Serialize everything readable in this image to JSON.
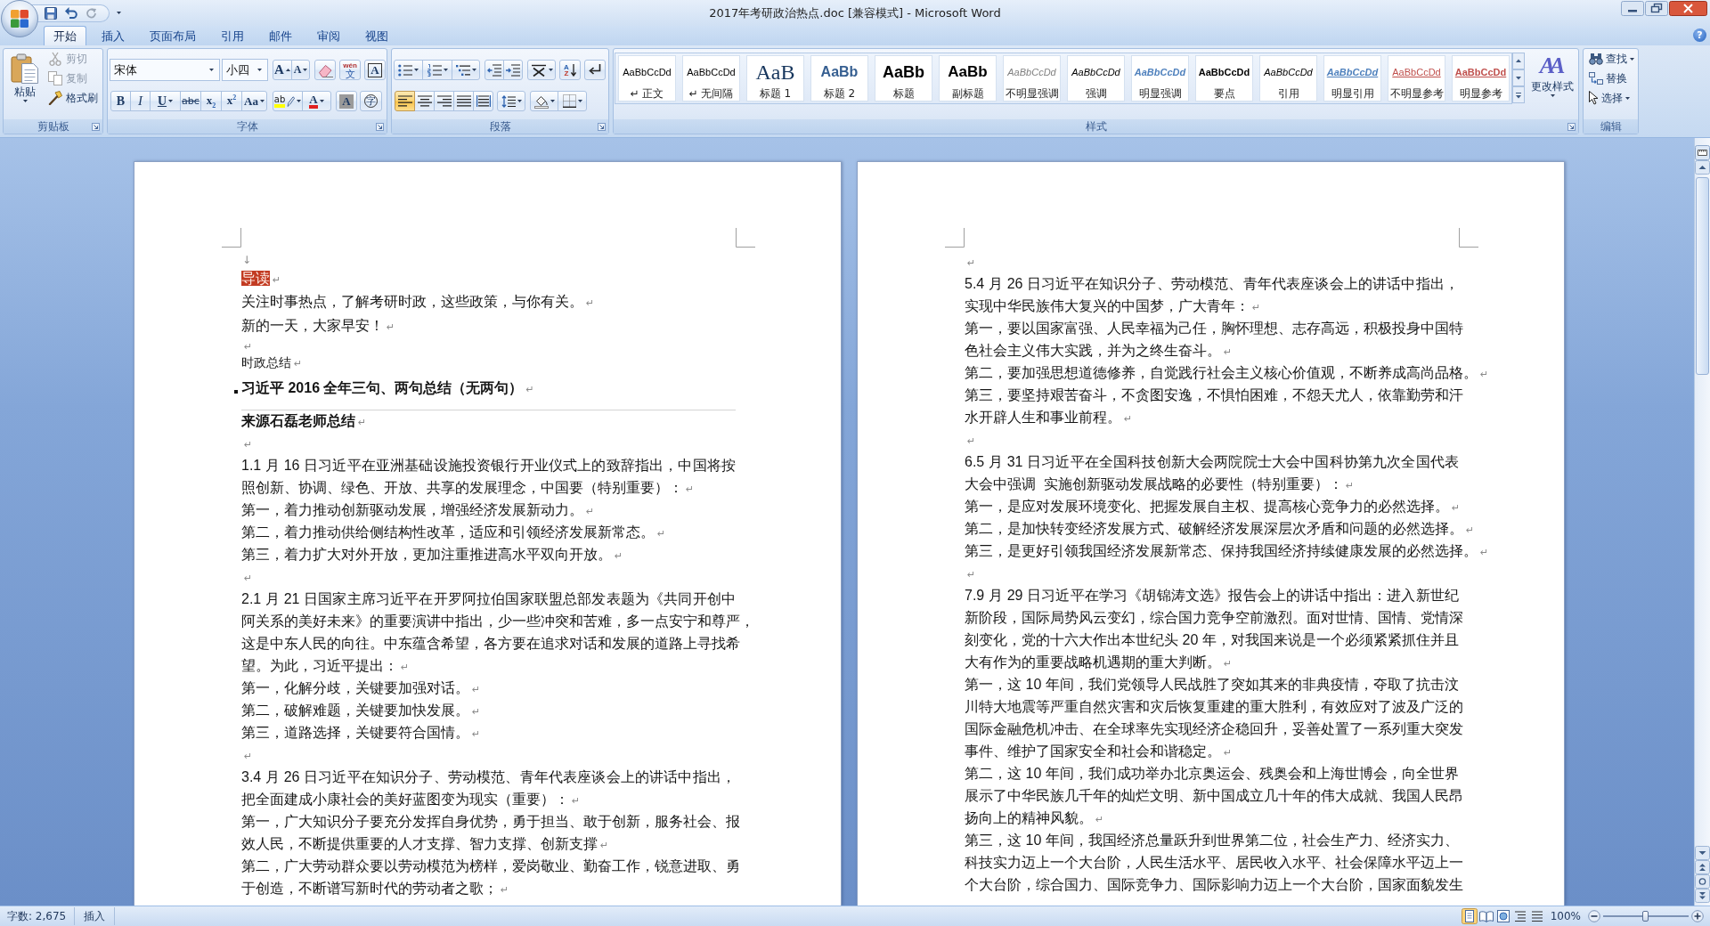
{
  "title_bar": {
    "title": "2017年考研政治热点.doc [兼容模式] - Microsoft Word"
  },
  "tabs": [
    {
      "label": "开始",
      "selected": true
    },
    {
      "label": "插入",
      "selected": false
    },
    {
      "label": "页面布局",
      "selected": false
    },
    {
      "label": "引用",
      "selected": false
    },
    {
      "label": "邮件",
      "selected": false
    },
    {
      "label": "审阅",
      "selected": false
    },
    {
      "label": "视图",
      "selected": false
    }
  ],
  "help": "?",
  "ribbon": {
    "clipboard": {
      "label": "剪贴板",
      "paste": "粘贴",
      "tools": [
        {
          "kind": "cut",
          "label": "剪切",
          "disabled": true
        },
        {
          "kind": "copy",
          "label": "复制",
          "disabled": true
        },
        {
          "kind": "painter",
          "label": "格式刷",
          "disabled": false
        }
      ]
    },
    "font": {
      "label": "字体",
      "font_name": "宋体",
      "font_size": "小四",
      "tools_1": [
        [
          {
            "kind": "grow",
            "text": "A"
          },
          {
            "kind": "shrink",
            "text": "A"
          }
        ],
        [
          {
            "kind": "clear"
          }
        ],
        [
          {
            "kind": "phonetic",
            "ruby": "wén",
            "text": "文"
          }
        ],
        [
          {
            "kind": "border",
            "text": "A"
          }
        ]
      ],
      "tools_2": [
        [
          {
            "kind": "bold",
            "text": "B"
          },
          {
            "kind": "italic",
            "text": "I"
          },
          {
            "kind": "underline",
            "text": "U"
          },
          {
            "kind": "strike",
            "text": "abc"
          },
          {
            "kind": "subscript",
            "text": "x$_{2}$"
          },
          {
            "kind": "superscript",
            "text": "x$^{2}$"
          },
          {
            "kind": "case",
            "text": "Aa"
          }
        ],
        [
          {
            "kind": "highlight",
            "text": "ab"
          },
          {
            "kind": "color",
            "text": "A"
          }
        ],
        [
          {
            "kind": "char-shading",
            "text": "A"
          }
        ],
        [
          {
            "kind": "enclose",
            "text": "字"
          }
        ]
      ]
    },
    "paragraph": {
      "label": "段落",
      "tools_1": [
        [
          {
            "kind": "bullets"
          },
          {
            "kind": "numbering"
          },
          {
            "kind": "multilevel"
          }
        ],
        [
          {
            "kind": "outdent"
          },
          {
            "kind": "indent"
          }
        ],
        [
          {
            "kind": "asian"
          }
        ],
        [
          {
            "kind": "sort",
            "letters": [
              "A",
              "Z"
            ]
          }
        ],
        [
          {
            "kind": "marks"
          }
        ]
      ],
      "alignment": [
        {
          "kind": "align-left",
          "selected": true
        },
        {
          "kind": "align-center",
          "selected": false
        },
        {
          "kind": "align-right",
          "selected": false
        },
        {
          "kind": "justify",
          "selected": false
        },
        {
          "kind": "distribute",
          "selected": false
        }
      ],
      "tools_2": [
        [
          {
            "kind": "line-spacing"
          }
        ],
        [
          {
            "kind": "shading"
          },
          {
            "kind": "borders"
          }
        ]
      ]
    },
    "styles": {
      "label": "样式",
      "gallery": [
        {
          "preview": "AaBbCcDd",
          "name": "↵ 正文",
          "kind": "normal"
        },
        {
          "preview": "AaBbCcDd",
          "name": "↵ 无间隔",
          "kind": "normal"
        },
        {
          "preview": "AaB",
          "name": "标题 1",
          "kind": "heading1"
        },
        {
          "preview": "AaBb",
          "name": "标题 2",
          "kind": "heading2"
        },
        {
          "preview": "AaBb",
          "name": "标题",
          "kind": "title"
        },
        {
          "preview": "AaBb",
          "name": "副标题",
          "kind": "subtitle"
        },
        {
          "preview": "AaBbCcDd",
          "name": "不明显强调",
          "kind": "subtle-emphasis"
        },
        {
          "preview": "AaBbCcDd",
          "name": "强调",
          "kind": "emphasis"
        },
        {
          "preview": "AaBbCcDd",
          "name": "明显强调",
          "kind": "intense-emphasis"
        },
        {
          "preview": "AaBbCcDd",
          "name": "要点",
          "kind": "strong"
        },
        {
          "preview": "AaBbCcDd",
          "name": "引用",
          "kind": "quote"
        },
        {
          "preview": "AaBbCcDd",
          "name": "明显引用",
          "kind": "intense-quote"
        },
        {
          "preview": "AaBbCcDd",
          "name": "不明显参考",
          "kind": "subtle-reference"
        },
        {
          "preview": "AaBbCcDd",
          "name": "明显参考",
          "kind": "intense-reference"
        }
      ],
      "change_styles": {
        "glyph": "AA",
        "label": "更改样式"
      }
    },
    "editing": {
      "label": "编辑",
      "tools": [
        {
          "kind": "find",
          "label": "查找"
        },
        {
          "kind": "replace",
          "label": "替换"
        },
        {
          "kind": "select",
          "label": "选择"
        }
      ]
    }
  },
  "document": {
    "pages": [
      {
        "paragraphs": [
          {
            "kind": "break",
            "mark": "↓"
          },
          {
            "kind": "highlight",
            "lines": [
              "导读"
            ],
            "mark": "↵"
          },
          {
            "kind": "intro",
            "lines": [
              "关注时事热点，了解考研时政，这些政策，与你有关。"
            ],
            "mark": "↵"
          },
          {
            "kind": "intro",
            "lines": [
              "新的一天，大家早安！"
            ],
            "mark": "↵"
          },
          {
            "kind": "small",
            "mark": "↵"
          },
          {
            "kind": "small",
            "lines": [
              "时政总结"
            ],
            "mark": "↵"
          },
          {
            "kind": "heading",
            "lines": [
              "习近平 2016 全年三句、两句总结（无两句）"
            ],
            "mark": "↵"
          },
          {
            "kind": "bold",
            "lines": [
              "来源石磊老师总结"
            ],
            "mark": "↵"
          },
          {
            "kind": "body",
            "mark": "↵"
          },
          {
            "kind": "body",
            "lines": [
              "1.1 月 16 日习近平在亚洲基础设施投资银行开业仪式上的致辞指出，中国将按",
              "照创新、协调、绿色、开放、共享的发展理念，中国要（特别重要）："
            ],
            "mark": "↵"
          },
          {
            "kind": "body",
            "lines": [
              "第一，着力推动创新驱动发展，增强经济发展新动力。"
            ],
            "mark": "↵"
          },
          {
            "kind": "body",
            "lines": [
              "第二，着力推动供给侧结构性改革，适应和引领经济发展新常态。"
            ],
            "mark": "↵"
          },
          {
            "kind": "body",
            "lines": [
              "第三，着力扩大对外开放，更加注重推进高水平双向开放。"
            ],
            "mark": "↵"
          },
          {
            "kind": "body",
            "mark": "↵"
          },
          {
            "kind": "body",
            "lines": [
              "2.1 月 21 日国家主席习近平在开罗阿拉伯国家联盟总部发表题为《共同开创中",
              "阿关系的美好未来》的重要演讲中指出，少一些冲突和苦难，多一点安宁和尊严，",
              "这是中东人民的向往。中东蕴含希望，各方要在追求对话和发展的道路上寻找希",
              "望。为此，习近平提出："
            ],
            "mark": "↵"
          },
          {
            "kind": "body",
            "lines": [
              "第一，化解分歧，关键要加强对话。"
            ],
            "mark": "↵"
          },
          {
            "kind": "body",
            "lines": [
              "第二，破解难题，关键要加快发展。"
            ],
            "mark": "↵"
          },
          {
            "kind": "body",
            "lines": [
              "第三，道路选择，关键要符合国情。"
            ],
            "mark": "↵"
          },
          {
            "kind": "body",
            "mark": "↵"
          },
          {
            "kind": "body",
            "lines": [
              "3.4 月 26 日习近平在知识分子、劳动模范、青年代表座谈会上的讲话中指出，",
              "把全面建成小康社会的美好蓝图变为现实（重要）："
            ],
            "mark": "↵"
          },
          {
            "kind": "body",
            "lines": [
              "第一，广大知识分子要充分发挥自身优势，勇于担当、敢于创新，服务社会、报",
              "效人民，不断提供重要的人才支撑、智力支撑、创新支撑"
            ],
            "mark": "↵"
          },
          {
            "kind": "body",
            "lines": [
              "第二，广大劳动群众要以劳动模范为榜样，爱岗敬业、勤奋工作，锐意进取、勇",
              "于创造，不断谱写新时代的劳动者之歌；"
            ],
            "mark": "↵"
          }
        ]
      },
      {
        "paragraphs": [
          {
            "kind": "body",
            "mark": "↵"
          },
          {
            "kind": "body",
            "lines": [
              "5.4 月 26 日习近平在知识分子、劳动模范、青年代表座谈会上的讲话中指出，",
              "实现中华民族伟大复兴的中国梦，广大青年："
            ],
            "mark": "↵"
          },
          {
            "kind": "body",
            "lines": [
              "第一，要以国家富强、人民幸福为己任，胸怀理想、志存高远，积极投身中国特",
              "色社会主义伟大实践，并为之终生奋斗。"
            ],
            "mark": "↵"
          },
          {
            "kind": "body",
            "lines": [
              "第二，要加强思想道德修养，自觉践行社会主义核心价值观，不断养成高尚品格。"
            ],
            "mark": "↵"
          },
          {
            "kind": "body",
            "lines": [
              "第三，要坚持艰苦奋斗，不贪图安逸，不惧怕困难，不怨天尤人，依靠勤劳和汗",
              "水开辟人生和事业前程。"
            ],
            "mark": "↵"
          },
          {
            "kind": "body",
            "mark": "↵"
          },
          {
            "kind": "body",
            "lines": [
              "6.5 月 31 日习近平在全国科技创新大会两院院士大会中国科协第九次全国代表",
              "大会中强调  实施创新驱动发展战略的必要性（特别重要）："
            ],
            "mark": "↵"
          },
          {
            "kind": "body",
            "lines": [
              "第一，是应对发展环境变化、把握发展自主权、提高核心竞争力的必然选择。"
            ],
            "mark": "↵"
          },
          {
            "kind": "body",
            "lines": [
              "第二，是加快转变经济发展方式、破解经济发展深层次矛盾和问题的必然选择。"
            ],
            "mark": "↵"
          },
          {
            "kind": "body",
            "lines": [
              "第三，是更好引领我国经济发展新常态、保持我国经济持续健康发展的必然选择。"
            ],
            "mark": "↵"
          },
          {
            "kind": "body",
            "mark": "↵"
          },
          {
            "kind": "body",
            "lines": [
              "7.9 月 29 日习近平在学习《胡锦涛文选》报告会上的讲话中指出：进入新世纪",
              "新阶段，国际局势风云变幻，综合国力竞争空前激烈。面对世情、国情、党情深",
              "刻变化，党的十六大作出本世纪头 20 年，对我国来说是一个必须紧紧抓住并且",
              "大有作为的重要战略机遇期的重大判断。"
            ],
            "mark": "↵"
          },
          {
            "kind": "body",
            "lines": [
              "第一，这 10 年间，我们党领导人民战胜了突如其来的非典疫情，夺取了抗击汶",
              "川特大地震等严重自然灾害和灾后恢复重建的重大胜利，有效应对了波及广泛的",
              "国际金融危机冲击、在全球率先实现经济企稳回升，妥善处置了一系列重大突发",
              "事件、维护了国家安全和社会和谐稳定。"
            ],
            "mark": "↵"
          },
          {
            "kind": "body",
            "lines": [
              "第二，这 10 年间，我们成功举办北京奥运会、残奥会和上海世博会，向全世界",
              "展示了中华民族几千年的灿烂文明、新中国成立几十年的伟大成就、我国人民昂",
              "扬向上的精神风貌。"
            ],
            "mark": "↵"
          },
          {
            "kind": "body",
            "lines": [
              "第三，这 10 年间，我国经济总量跃升到世界第二位，社会生产力、经济实力、",
              "科技实力迈上一个大台阶，人民生活水平、居民收入水平、社会保障水平迈上一",
              "个大台阶，综合国力、国际竞争力、国际影响力迈上一个大台阶，国家面貌发生"
            ]
          }
        ]
      }
    ]
  },
  "status_bar": {
    "word_count": "字数: 2,675",
    "mode": "插入",
    "views": [
      {
        "kind": "print",
        "selected": true
      },
      {
        "kind": "reading",
        "selected": false
      },
      {
        "kind": "web",
        "selected": false
      },
      {
        "kind": "outline",
        "selected": false
      },
      {
        "kind": "draft",
        "selected": false
      }
    ],
    "zoom": "100%",
    "zoom_slider": {
      "level": 0.5
    }
  }
}
